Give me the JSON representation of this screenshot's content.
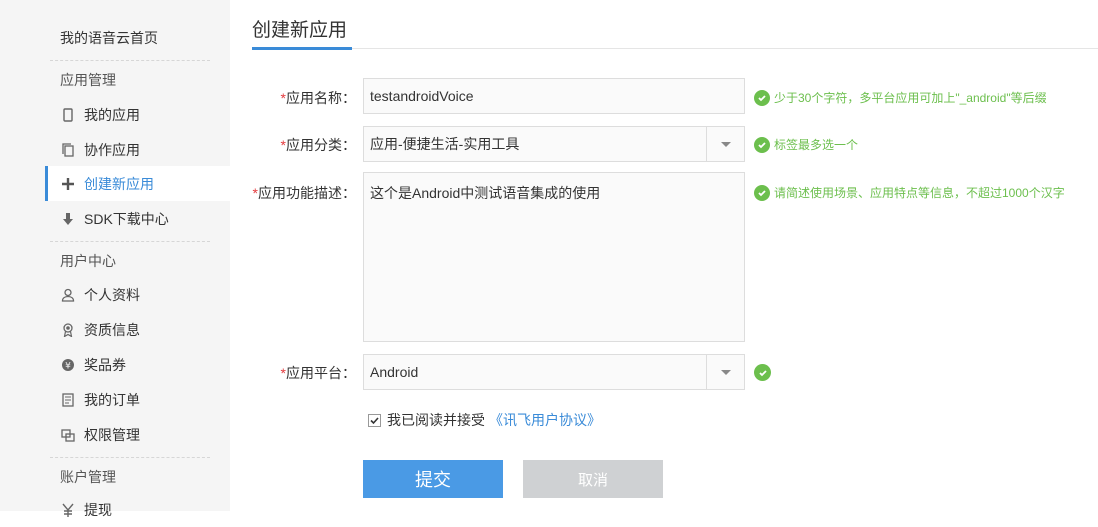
{
  "sidebar": {
    "home": "我的语音云首页",
    "groups": [
      "应用管理",
      "用户中心",
      "账户管理"
    ],
    "items": [
      {
        "label": "我的应用",
        "icon": "phone-icon"
      },
      {
        "label": "协作应用",
        "icon": "copy-icon"
      },
      {
        "label": "创建新应用",
        "icon": "plus-icon"
      },
      {
        "label": "SDK下载中心",
        "icon": "download-icon"
      },
      {
        "label": "个人资料",
        "icon": "user-icon"
      },
      {
        "label": "资质信息",
        "icon": "award-icon"
      },
      {
        "label": "奖品券",
        "icon": "coin-icon"
      },
      {
        "label": "我的订单",
        "icon": "order-icon"
      },
      {
        "label": "权限管理",
        "icon": "permission-icon"
      },
      {
        "label": "提现",
        "icon": "yen-icon"
      }
    ]
  },
  "main": {
    "title": "创建新应用",
    "form": {
      "name": {
        "label": "应用名称：",
        "value": "testandroidVoice",
        "hint": "少于30个字符，多平台应用可加上\"_android\"等后缀"
      },
      "category": {
        "label": "应用分类：",
        "value": "应用-便捷生活-实用工具",
        "hint": "标签最多选一个"
      },
      "description": {
        "label": "应用功能描述：",
        "value": "这个是Android中测试语音集成的使用",
        "hint": "请简述使用场景、应用特点等信息，不超过1000个汉字"
      },
      "platform": {
        "label": "应用平台：",
        "value": "Android"
      },
      "required_mark": "*"
    },
    "agreement": {
      "text": "我已阅读并接受",
      "link": "《讯飞用户协议》",
      "checked": true
    },
    "buttons": {
      "submit": "提交",
      "cancel": "取消"
    }
  },
  "colors": {
    "accent": "#3a8bd8",
    "hint_green": "#6cbf4d",
    "required_red": "#e4393c"
  }
}
